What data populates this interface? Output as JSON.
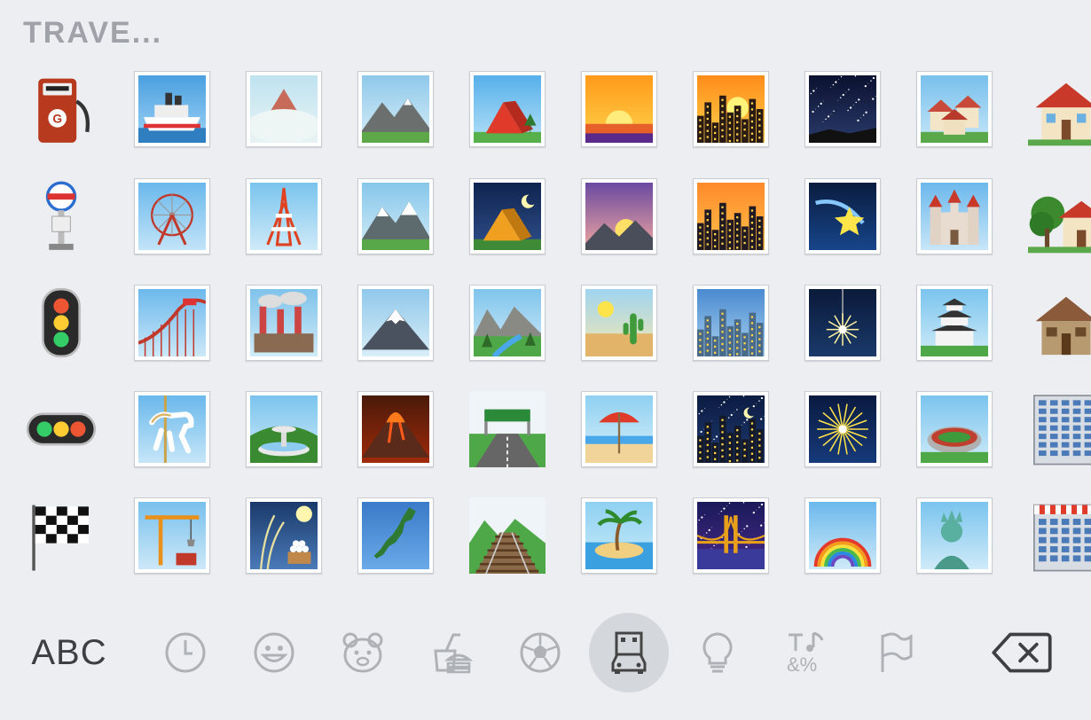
{
  "section": {
    "title": "TRAVE..."
  },
  "keyboard": {
    "abc_label": "ABC",
    "categories": [
      {
        "name": "recent",
        "icon": "clock-icon",
        "active": false
      },
      {
        "name": "smileys",
        "icon": "smiley-icon",
        "active": false
      },
      {
        "name": "animals",
        "icon": "bear-face-icon",
        "active": false
      },
      {
        "name": "food",
        "icon": "burger-drink-icon",
        "active": false
      },
      {
        "name": "activity",
        "icon": "soccer-ball-icon",
        "active": false
      },
      {
        "name": "travel",
        "icon": "car-building-icon",
        "active": true
      },
      {
        "name": "objects",
        "icon": "light-bulb-icon",
        "active": false
      },
      {
        "name": "symbols",
        "icon": "symbols-icon",
        "active": false
      },
      {
        "name": "flags",
        "icon": "flag-icon",
        "active": false
      }
    ],
    "delete_icon": "backspace-icon"
  },
  "emoji_rows": [
    [
      "fuel-pump",
      "ship",
      "mount-fuji-clouds",
      "mountain",
      "tent",
      "sunrise",
      "city-sunset",
      "milky-way",
      "houses",
      "house"
    ],
    [
      "bus-stop",
      "ferris-wheel",
      "tokyo-tower",
      "snow-mountain",
      "camping-night",
      "sunrise-mountains",
      "city-dusk",
      "shooting-star",
      "castle",
      "house-garden"
    ],
    [
      "vertical-traffic-light",
      "roller-coaster",
      "factory",
      "mount-fuji",
      "national-park",
      "desert",
      "cityscape",
      "sparkler",
      "japanese-castle",
      "derelict-house"
    ],
    [
      "horizontal-traffic-light",
      "carousel-horse",
      "fountain",
      "volcano",
      "motorway",
      "beach-umbrella",
      "night-stars",
      "fireworks",
      "stadium",
      "office-building"
    ],
    [
      "checkered-flag",
      "construction-crane",
      "moon-viewing",
      "map-of-japan",
      "railway-track",
      "desert-island",
      "bridge-night",
      "rainbow",
      "statue-of-liberty",
      "department-store"
    ]
  ],
  "colors": {
    "background": "#eceef1",
    "section_title": "#9fa2a8",
    "icon_gray": "#aeb1b6",
    "active_pill": "#d4d7dc",
    "key_text": "#3c3f44"
  }
}
